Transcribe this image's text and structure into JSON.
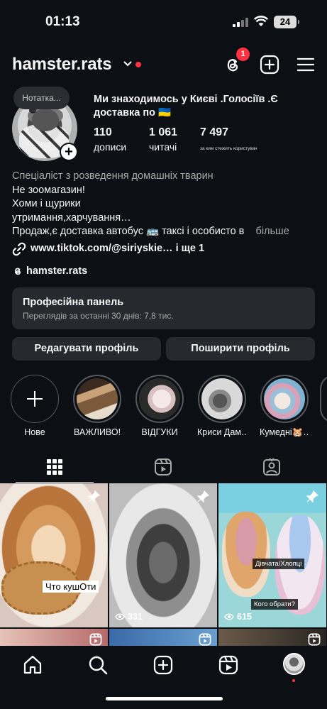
{
  "status_bar": {
    "time": "01:13",
    "battery": "24"
  },
  "header": {
    "username": "hamster.rats",
    "threads_badge": "1"
  },
  "profile": {
    "note": "Нотатка...",
    "full_name": "Ми знаходимось у Києві .Голосіїв .Є доставка по 🇺🇦",
    "stats": [
      {
        "value": "110",
        "label": "дописи"
      },
      {
        "value": "1 061",
        "label": "читачі"
      },
      {
        "value": "7 497",
        "label": "за ким стежить користувач"
      }
    ],
    "bio": {
      "category": "Спеціаліст з розведення домашніх тварин",
      "lines": [
        "Не зоомагазин!",
        "Хоми і щурики",
        "утримання,харчування…",
        "Продаж,є доставка автобус 🚌 таксі і особисто в"
      ],
      "more": "більше"
    },
    "link": "www.tiktok.com/@siriyskie…  і ще 1",
    "threads_handle": "hamster.rats"
  },
  "pro_panel": {
    "title": "Професійна панель",
    "subtitle": "Переглядів за останні 30 днів: 7,8 тис."
  },
  "buttons": {
    "edit": "Редагувати профіль",
    "share": "Поширити профіль"
  },
  "highlights": [
    {
      "label": "Нове"
    },
    {
      "label": "ВАЖЛИВО!"
    },
    {
      "label": "ВІДГУКИ"
    },
    {
      "label": "Криси Дам…"
    },
    {
      "label": "Кумедні🐹…"
    }
  ],
  "grid": {
    "posts": [
      {
        "caption": "Что кушОти",
        "pinned": true,
        "views": ""
      },
      {
        "caption": "",
        "pinned": true,
        "views": "331"
      },
      {
        "caption": "",
        "pinned": true,
        "views": "615",
        "sticker1": "Дівчата/Хлопці",
        "sticker2": "Кого обрати?"
      }
    ]
  },
  "colors": {
    "background": "#0c1014",
    "surface": "#262a2e",
    "accent_red": "#ff3040"
  }
}
